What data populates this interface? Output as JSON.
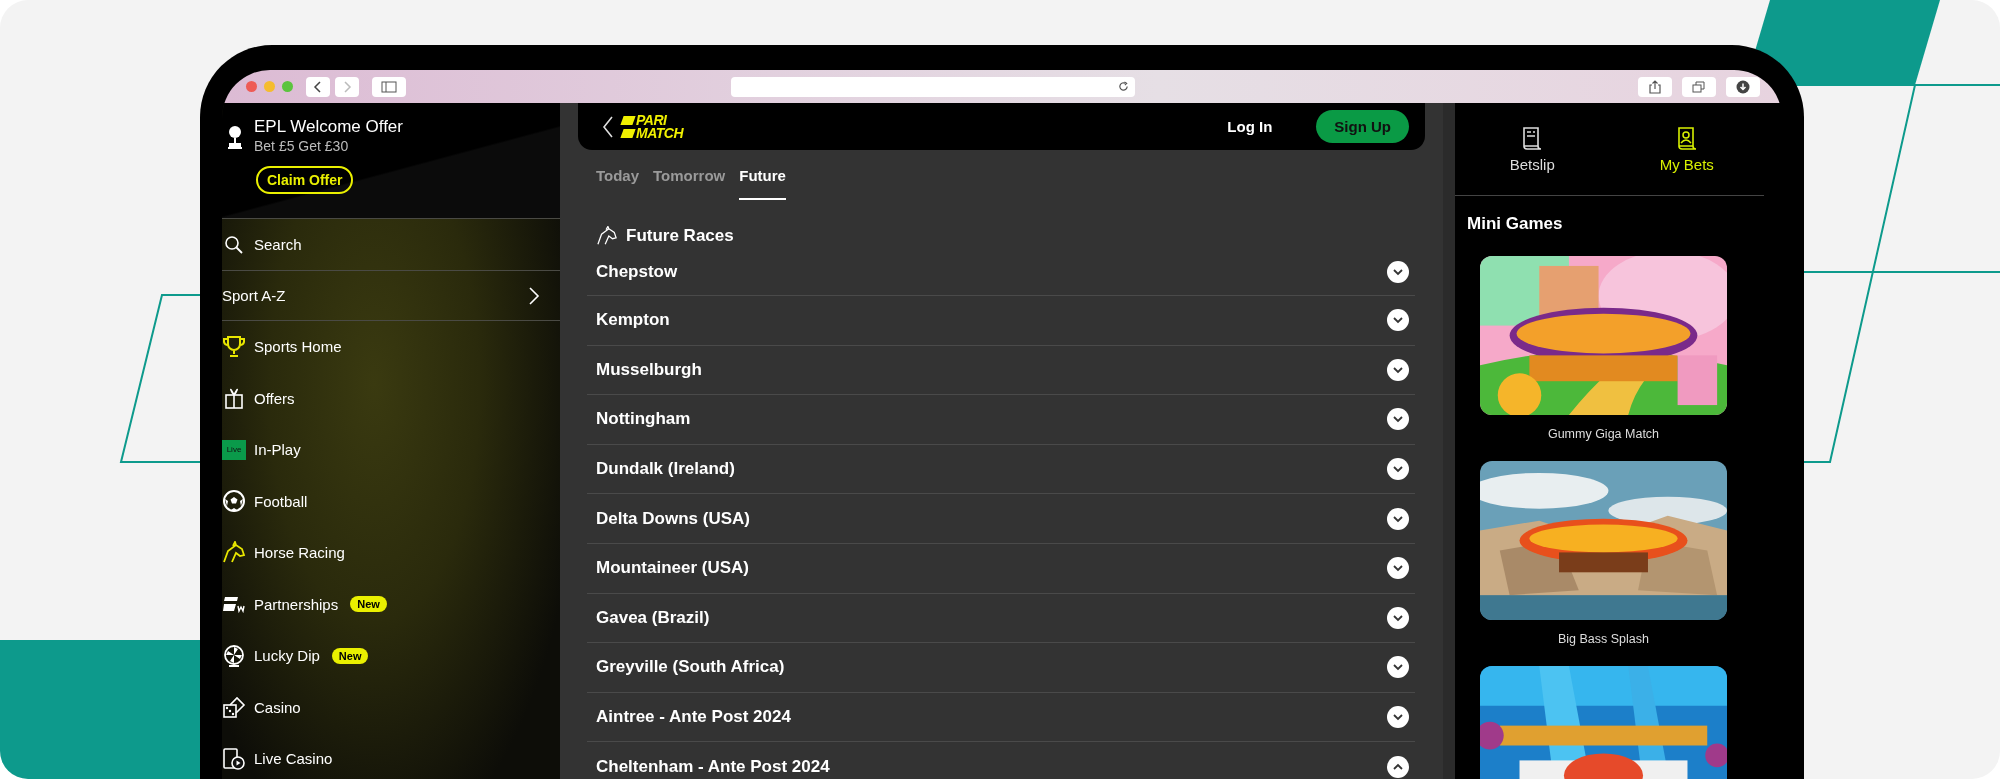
{
  "promo": {
    "title": "EPL Welcome Offer",
    "subtitle": "Bet £5 Get £30",
    "button": "Claim Offer"
  },
  "sidebar": {
    "search": "Search",
    "sport_az": "Sport A-Z",
    "items": [
      {
        "label": "Sports Home"
      },
      {
        "label": "Offers"
      },
      {
        "label": "In-Play",
        "live_tag": "Live"
      },
      {
        "label": "Football"
      },
      {
        "label": "Horse Racing"
      },
      {
        "label": "Partnerships",
        "tag": "New"
      },
      {
        "label": "Lucky Dip",
        "tag": "New"
      },
      {
        "label": "Casino"
      },
      {
        "label": "Live Casino"
      }
    ]
  },
  "header": {
    "logo": [
      "PARI",
      "MATCH"
    ],
    "login": "Log In",
    "signup": "Sign Up"
  },
  "tabs": [
    {
      "label": "Today",
      "selected": false
    },
    {
      "label": "Tomorrow",
      "selected": false
    },
    {
      "label": "Future",
      "selected": true
    }
  ],
  "section_title": "Future Races",
  "races": [
    {
      "name": "Chepstow",
      "expanded": false
    },
    {
      "name": "Kempton",
      "expanded": false
    },
    {
      "name": "Musselburgh",
      "expanded": false
    },
    {
      "name": "Nottingham",
      "expanded": false
    },
    {
      "name": "Dundalk (Ireland)",
      "expanded": false
    },
    {
      "name": "Delta Downs (USA)",
      "expanded": false
    },
    {
      "name": "Mountaineer (USA)",
      "expanded": false
    },
    {
      "name": "Gavea (Brazil)",
      "expanded": false
    },
    {
      "name": "Greyville (South Africa)",
      "expanded": false
    },
    {
      "name": "Aintree - Ante Post 2024",
      "expanded": false
    },
    {
      "name": "Cheltenham - Ante Post 2024",
      "expanded": true
    }
  ],
  "right_tabs": [
    {
      "label": "Betslip",
      "selected": false
    },
    {
      "label": "My Bets",
      "selected": true
    }
  ],
  "mini_games": {
    "title": "Mini Games",
    "games": [
      {
        "kind": "picture",
        "caption": "Gummy Giga Match"
      },
      {
        "kind": "picture",
        "caption": "Big Bass Splash"
      },
      {
        "kind": "picture"
      }
    ]
  }
}
